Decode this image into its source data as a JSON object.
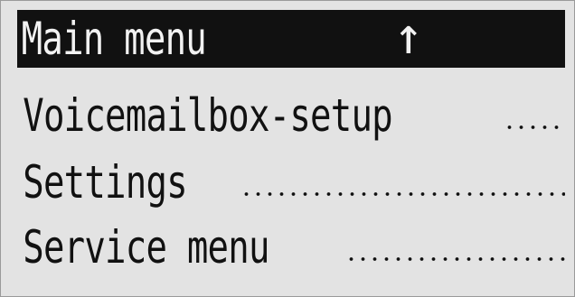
{
  "header": {
    "title": "Main menu",
    "indicator_icon": "up-arrow-icon",
    "indicator_glyph": "↑"
  },
  "menu": {
    "items": [
      {
        "label": "Voicemailbox-setup"
      },
      {
        "label": "Settings"
      },
      {
        "label": "Service menu"
      }
    ]
  },
  "colors": {
    "background": "#e3e3e3",
    "foreground": "#111111",
    "highlight_bg": "#111111",
    "highlight_fg": "#f2f2f2"
  }
}
